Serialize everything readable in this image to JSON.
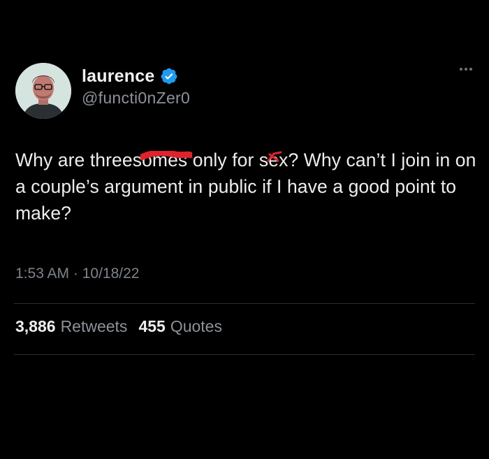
{
  "tweet": {
    "user": {
      "display_name": "laurence",
      "handle": "@functi0nZer0",
      "verified": true,
      "avatar_icon": "profile-photo",
      "verified_color": "#1d9bf0"
    },
    "text": {
      "part1": "Why are threes",
      "redacted1": "omes",
      "part2": " only for s",
      "redacted2": "e",
      "part3": "x? Why can’t I join in on a couple’s argument in public if I have a good point to make?"
    },
    "timestamp": "1:53 AM · 10/18/22",
    "stats": {
      "retweets_count": "3,886",
      "retweets_label": "Retweets",
      "quotes_count": "455",
      "quotes_label": "Quotes"
    },
    "scribble_color": "#e0222a",
    "more_icon": "more-horizontal-icon"
  }
}
